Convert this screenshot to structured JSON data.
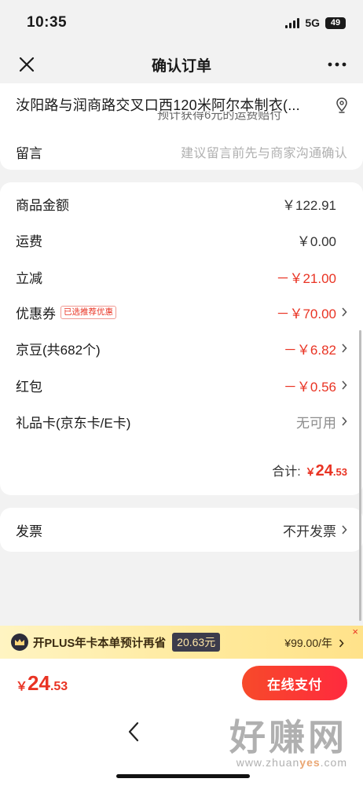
{
  "status_bar": {
    "time": "10:35",
    "network": "5G",
    "battery": "49"
  },
  "nav": {
    "title": "确认订单"
  },
  "address": {
    "line": "汝阳路与润商路交叉口西120米阿尔本制衣(...",
    "sub_note": "预计获得6元的运费赔付"
  },
  "remark": {
    "label": "留言",
    "placeholder": "建议留言前先与商家沟通确认"
  },
  "pricing": {
    "rows": [
      {
        "label": "商品金额",
        "value": "￥122.91"
      },
      {
        "label": "运费",
        "value": "￥0.00"
      },
      {
        "label": "立减",
        "value": "－￥21.00"
      },
      {
        "label": "优惠券",
        "tag": "已选推荐优惠",
        "value": "－￥70.00"
      },
      {
        "label": "京豆(共682个)",
        "value": "－￥6.82"
      },
      {
        "label": "红包",
        "value": "－￥0.56"
      },
      {
        "label": "礼品卡(京东卡/E卡)",
        "value": "无可用"
      }
    ],
    "total_label": "合计:",
    "total_currency": "￥",
    "total_int": "24",
    "total_dec": ".53"
  },
  "invoice": {
    "label": "发票",
    "value": "不开发票"
  },
  "plus_banner": {
    "text": "开PLUS年卡本单预计再省",
    "saving": "20.63元",
    "price": "¥99.00/年",
    "close": "×"
  },
  "bottom_bar": {
    "currency": "￥",
    "total_int": "24",
    "total_dec": ".53",
    "pay_label": "在线支付"
  },
  "watermark": {
    "main": "好赚网",
    "url_a": "www.zhuan",
    "url_b": "yes",
    "url_c": ".com"
  },
  "colors": {
    "accent_red": "#e93323",
    "plus_gold": "#ffe99a",
    "pay_gradient_start": "#f74a2a"
  }
}
